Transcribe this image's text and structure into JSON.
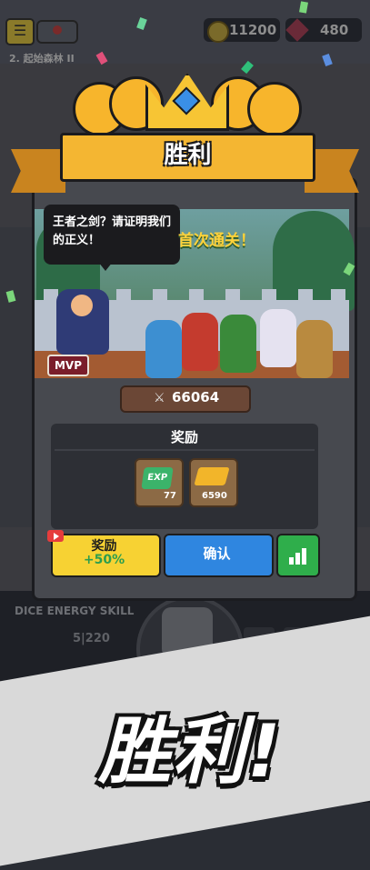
{
  "hud": {
    "menu_icon": "menu-icon",
    "coins": "11200",
    "gems": "480",
    "stage": "2. 起始森林 II"
  },
  "bottom": {
    "dice_label": "DICE ENERGY SKILL",
    "dice_value": "5|220"
  },
  "modal": {
    "title": "胜利",
    "speech": "王者之剑？请证明我们的正义！",
    "first_clear": "首次通关！",
    "mvp": "MVP",
    "score": "66064",
    "rewards_title": "奖励",
    "rewards": [
      {
        "name": "EXP",
        "value": "77"
      },
      {
        "name": "gold",
        "value": "6590"
      }
    ],
    "buttons": {
      "bonus_label": "奖励",
      "bonus_value": "+50%",
      "confirm": "确认"
    }
  },
  "promo_title": "胜利!",
  "colors": {
    "banner": "#f4b632",
    "confirm": "#2f86e0",
    "bonus": "#f7d233",
    "stats": "#2fae4b"
  }
}
